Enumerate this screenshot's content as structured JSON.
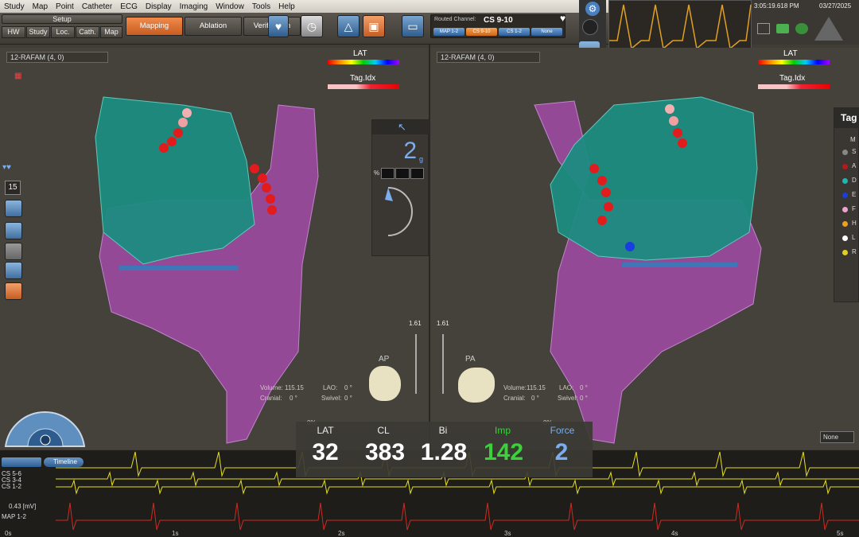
{
  "menu": [
    "Study",
    "Map",
    "Point",
    "Catheter",
    "ECG",
    "Display",
    "Imaging",
    "Window",
    "Tools",
    "Help"
  ],
  "setup": {
    "label": "Setup",
    "buttons": [
      "HW",
      "Study",
      "Loc.",
      "Cath.",
      "Map"
    ]
  },
  "modes": [
    {
      "label": "Mapping",
      "active": true
    },
    {
      "label": "Ablation",
      "active": false
    },
    {
      "label": "Verification",
      "active": false
    }
  ],
  "routed": {
    "label": "Routed Channel:",
    "value": "CS 9-10",
    "chips": [
      "MAP 1-2",
      "CS 9-10",
      "CS 1-2",
      "None"
    ]
  },
  "clock": "3:05:19.618 PM",
  "date": "03/27/2025",
  "left_view": {
    "map_name": "12-RAFAM (4, 0)",
    "lat_label": "LAT",
    "tag_label": "Tag.Idx",
    "orientation": "AP",
    "zoom": "1.61",
    "volume_label": "Volume:",
    "volume": "115.15",
    "cranial_label": "Cranial:",
    "cranial": "0 °",
    "lao_label": "LAO:",
    "lao": "0 °",
    "swivel_label": "Swivel:",
    "swivel": "0 °",
    "opacity": "0%",
    "tool_number": "15"
  },
  "right_view": {
    "map_name": "12-RAFAM (4, 0)",
    "lat_label": "LAT",
    "tag_label": "Tag.Idx",
    "orientation": "PA",
    "zoom": "1.61",
    "volume_label": "Volume:",
    "volume": "115.15",
    "cranial_label": "Cranial:",
    "cranial": "0 °",
    "lao_label": "LAO:",
    "lao": "0 °",
    "swivel_label": "Swivel:",
    "swivel": "0 °",
    "opacity": "0%"
  },
  "force_panel": {
    "value": "2",
    "unit": "g",
    "percent_label": "%"
  },
  "readout": [
    {
      "label": "LAT",
      "value": "32",
      "label_color": "#eeeeee",
      "value_color": "#ffffff"
    },
    {
      "label": "CL",
      "value": "383",
      "label_color": "#eeeeee",
      "value_color": "#ffffff"
    },
    {
      "label": "Bi",
      "value": "1.28",
      "label_color": "#eeeeee",
      "value_color": "#ffffff"
    },
    {
      "label": "Imp",
      "value": "142",
      "label_color": "#3ad13a",
      "value_color": "#3ad13a"
    },
    {
      "label": "Force",
      "value": "2",
      "label_color": "#7aaef0",
      "value_color": "#7aaef0"
    }
  ],
  "legend": {
    "title": "Tag",
    "dots": [
      "#888888",
      "#b81818",
      "#1fb5b0",
      "#1a3de0",
      "#f2a0d0",
      "#f0a020",
      "#ffffff",
      "#e0d020"
    ],
    "letters": [
      "M",
      "S",
      "A",
      "D",
      "E",
      "F",
      "H",
      "L",
      "R"
    ]
  },
  "ecg": {
    "timeline_label": "Timeline",
    "channels": [
      "CS 5-6",
      "CS 3-4",
      "CS 1-2",
      "MAP 1-2"
    ],
    "map_scale": "0.43 [mV]",
    "time_ticks": [
      "0s",
      "1s",
      "2s",
      "3s",
      "4s",
      "5s"
    ]
  },
  "none_select": "None"
}
